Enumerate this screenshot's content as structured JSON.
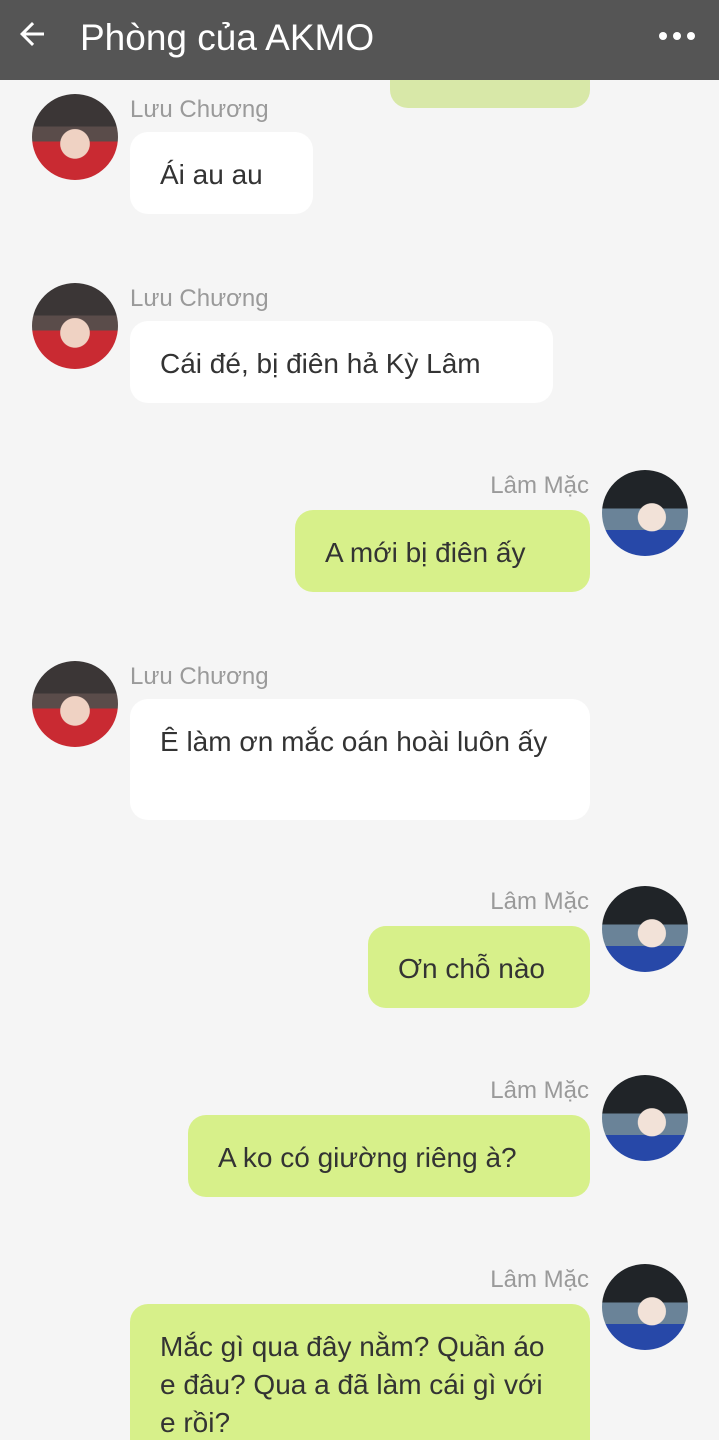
{
  "header": {
    "back_icon": "arrow-left-icon",
    "title": "Phòng của AKMO",
    "more_icon": "more-horizontal-icon"
  },
  "messages": [
    {
      "sender": "Lưu Chương",
      "side": "left",
      "text": "Ái au au"
    },
    {
      "sender": "Lưu Chương",
      "side": "left",
      "text": "Cái đé, bị điên hả Kỳ Lâm"
    },
    {
      "sender": "Lâm Mặc",
      "side": "right",
      "text": "A mới bị điên ấy"
    },
    {
      "sender": "Lưu Chương",
      "side": "left",
      "text": "Ê làm ơn mắc oán hoài luôn ấy"
    },
    {
      "sender": "Lâm Mặc",
      "side": "right",
      "text": "Ơn chỗ nào"
    },
    {
      "sender": "Lâm Mặc",
      "side": "right",
      "text": "A ko có giường riêng à?"
    },
    {
      "sender": "Lâm Mặc",
      "side": "right",
      "text": "Mắc gì qua đây nằm? Quần áo e đâu? Qua a đã làm cái gì với e rồi?"
    }
  ],
  "colors": {
    "app_bar": "#555555",
    "background": "#f5f5f5",
    "outgoing_bubble": "#d7f08a",
    "incoming_bubble": "#ffffff",
    "sender_name": "#9a9a9a"
  }
}
